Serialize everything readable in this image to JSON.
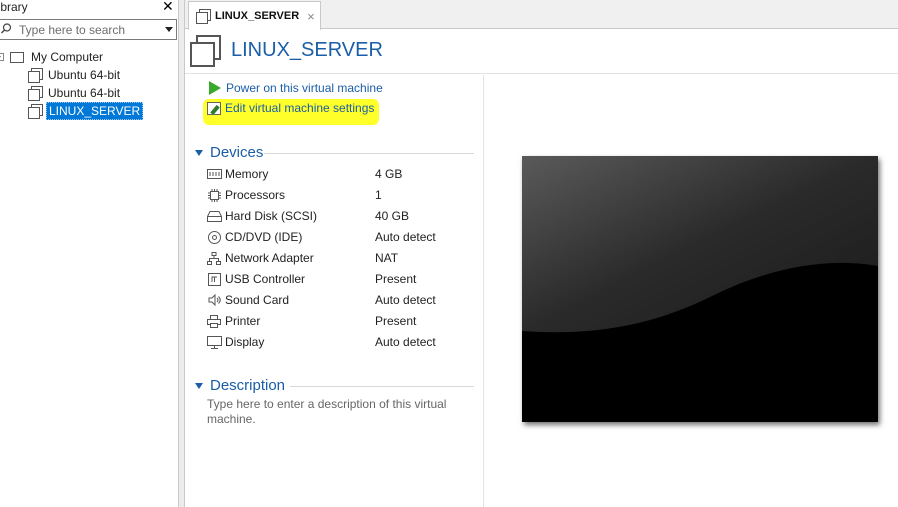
{
  "library": {
    "title": "Library",
    "search_placeholder": "Type here to search",
    "tree": [
      {
        "label": "My Computer",
        "selected": false
      },
      {
        "label": "Ubuntu 64-bit",
        "selected": false
      },
      {
        "label": "Ubuntu 64-bit",
        "selected": false
      },
      {
        "label": "LINUX_SERVER",
        "selected": true
      }
    ]
  },
  "tab": {
    "label": "LINUX_SERVER",
    "close": "×"
  },
  "vm": {
    "title": "LINUX_SERVER",
    "actions": {
      "power_on": "Power on this virtual machine",
      "edit_settings": "Edit virtual machine settings"
    },
    "devices_title": "Devices",
    "devices": [
      {
        "name": "Memory",
        "value": "4 GB",
        "icon": "memory-icon"
      },
      {
        "name": "Processors",
        "value": "1",
        "icon": "processor-icon"
      },
      {
        "name": "Hard Disk (SCSI)",
        "value": "40 GB",
        "icon": "harddisk-icon"
      },
      {
        "name": "CD/DVD (IDE)",
        "value": "Auto detect",
        "icon": "cd-icon"
      },
      {
        "name": "Network Adapter",
        "value": "NAT",
        "icon": "network-icon"
      },
      {
        "name": "USB Controller",
        "value": "Present",
        "icon": "usb-icon"
      },
      {
        "name": "Sound Card",
        "value": "Auto detect",
        "icon": "sound-icon"
      },
      {
        "name": "Printer",
        "value": "Present",
        "icon": "printer-icon"
      },
      {
        "name": "Display",
        "value": "Auto detect",
        "icon": "display-icon"
      }
    ],
    "description_title": "Description",
    "description_placeholder": "Type here to enter a description of this virtual machine."
  },
  "colors": {
    "accent": "#1a5ea8",
    "selection": "#0078d7",
    "highlight": "#ffff1f",
    "play": "#3aa82d"
  }
}
